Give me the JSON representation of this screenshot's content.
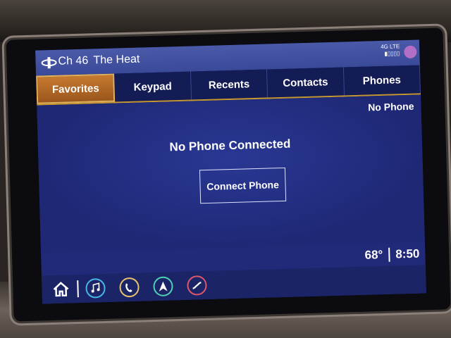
{
  "status": {
    "channel": "Ch 46",
    "station": "The Heat",
    "network": "4G LTE",
    "signal_bars": "▮▯▯▯▯"
  },
  "tabs": [
    {
      "label": "Favorites"
    },
    {
      "label": "Keypad"
    },
    {
      "label": "Recents"
    },
    {
      "label": "Contacts"
    },
    {
      "label": "Phones"
    }
  ],
  "content": {
    "phone_status": "No Phone",
    "message": "No Phone Connected",
    "connect_button": "Connect Phone"
  },
  "bottom": {
    "temperature": "68°",
    "time": "8:50"
  },
  "nav_icons": [
    {
      "name": "music-icon",
      "color": "#46b7e6"
    },
    {
      "name": "phone-icon",
      "color": "#e8c36a"
    },
    {
      "name": "navigation-icon",
      "color": "#4fd1b3"
    },
    {
      "name": "onstar-icon",
      "color": "#e0576a"
    }
  ]
}
